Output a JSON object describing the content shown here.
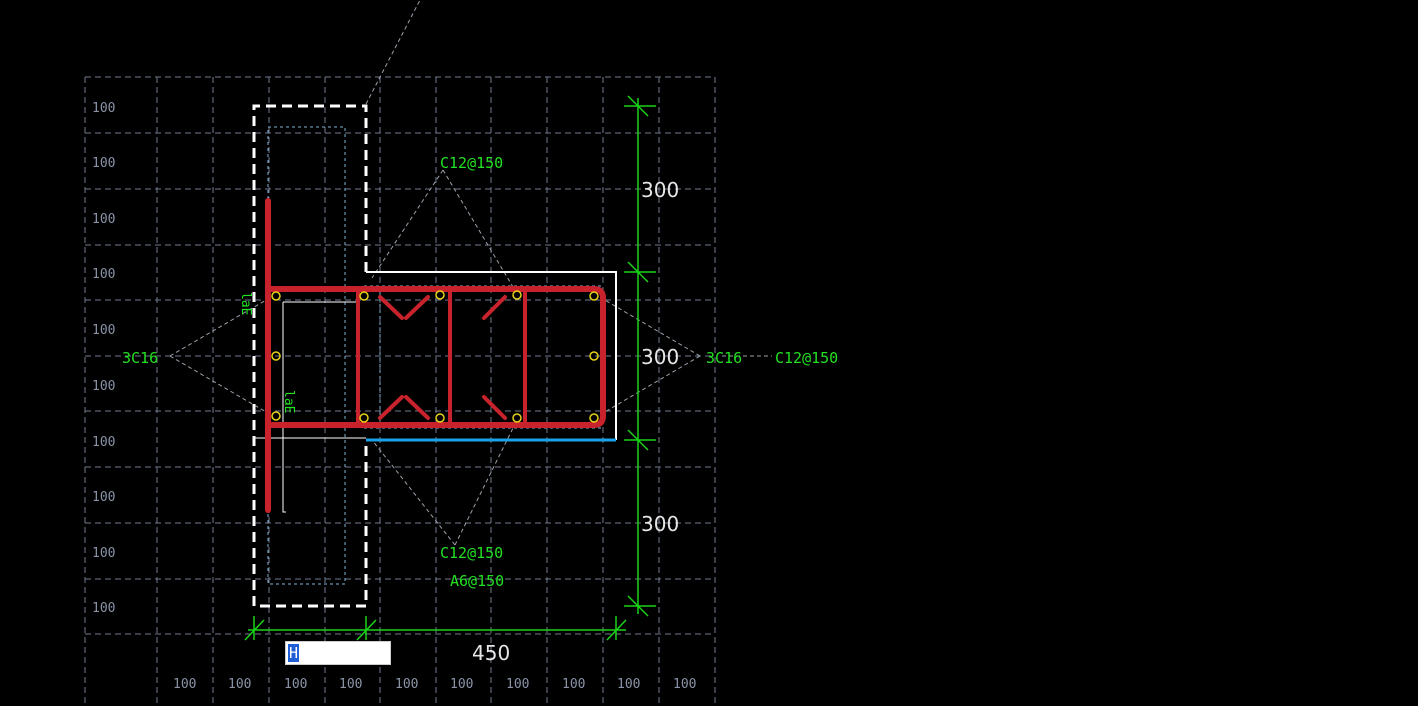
{
  "grid": {
    "row_labels": [
      "100",
      "100",
      "100",
      "100",
      "100",
      "100",
      "100",
      "100",
      "100",
      "100"
    ],
    "col_labels": [
      "100",
      "100",
      "100",
      "100",
      "100",
      "100",
      "100",
      "100",
      "100",
      "100"
    ]
  },
  "annotations": {
    "top_stirrup": "C12@150",
    "bottom_stirrup": "C12@150",
    "tie_bar": "A6@150",
    "left_rebar": "3C16",
    "right_rebar": "3C16",
    "right_stirrup": "C12@150",
    "lap_label_1": "laE",
    "lap_label_2": "laE"
  },
  "dimensions": {
    "vertical": [
      "300",
      "300",
      "300"
    ],
    "horizontal": "450"
  },
  "input": {
    "value": "H"
  },
  "colors": {
    "background": "#000000",
    "grid": "#8a94a8",
    "rebar": "#c8232c",
    "annotation": "#22e022",
    "dimension_line": "#19d419",
    "outline": "#ffffff",
    "edge_blue": "#1aa3e8",
    "node": "#e8d21a"
  }
}
